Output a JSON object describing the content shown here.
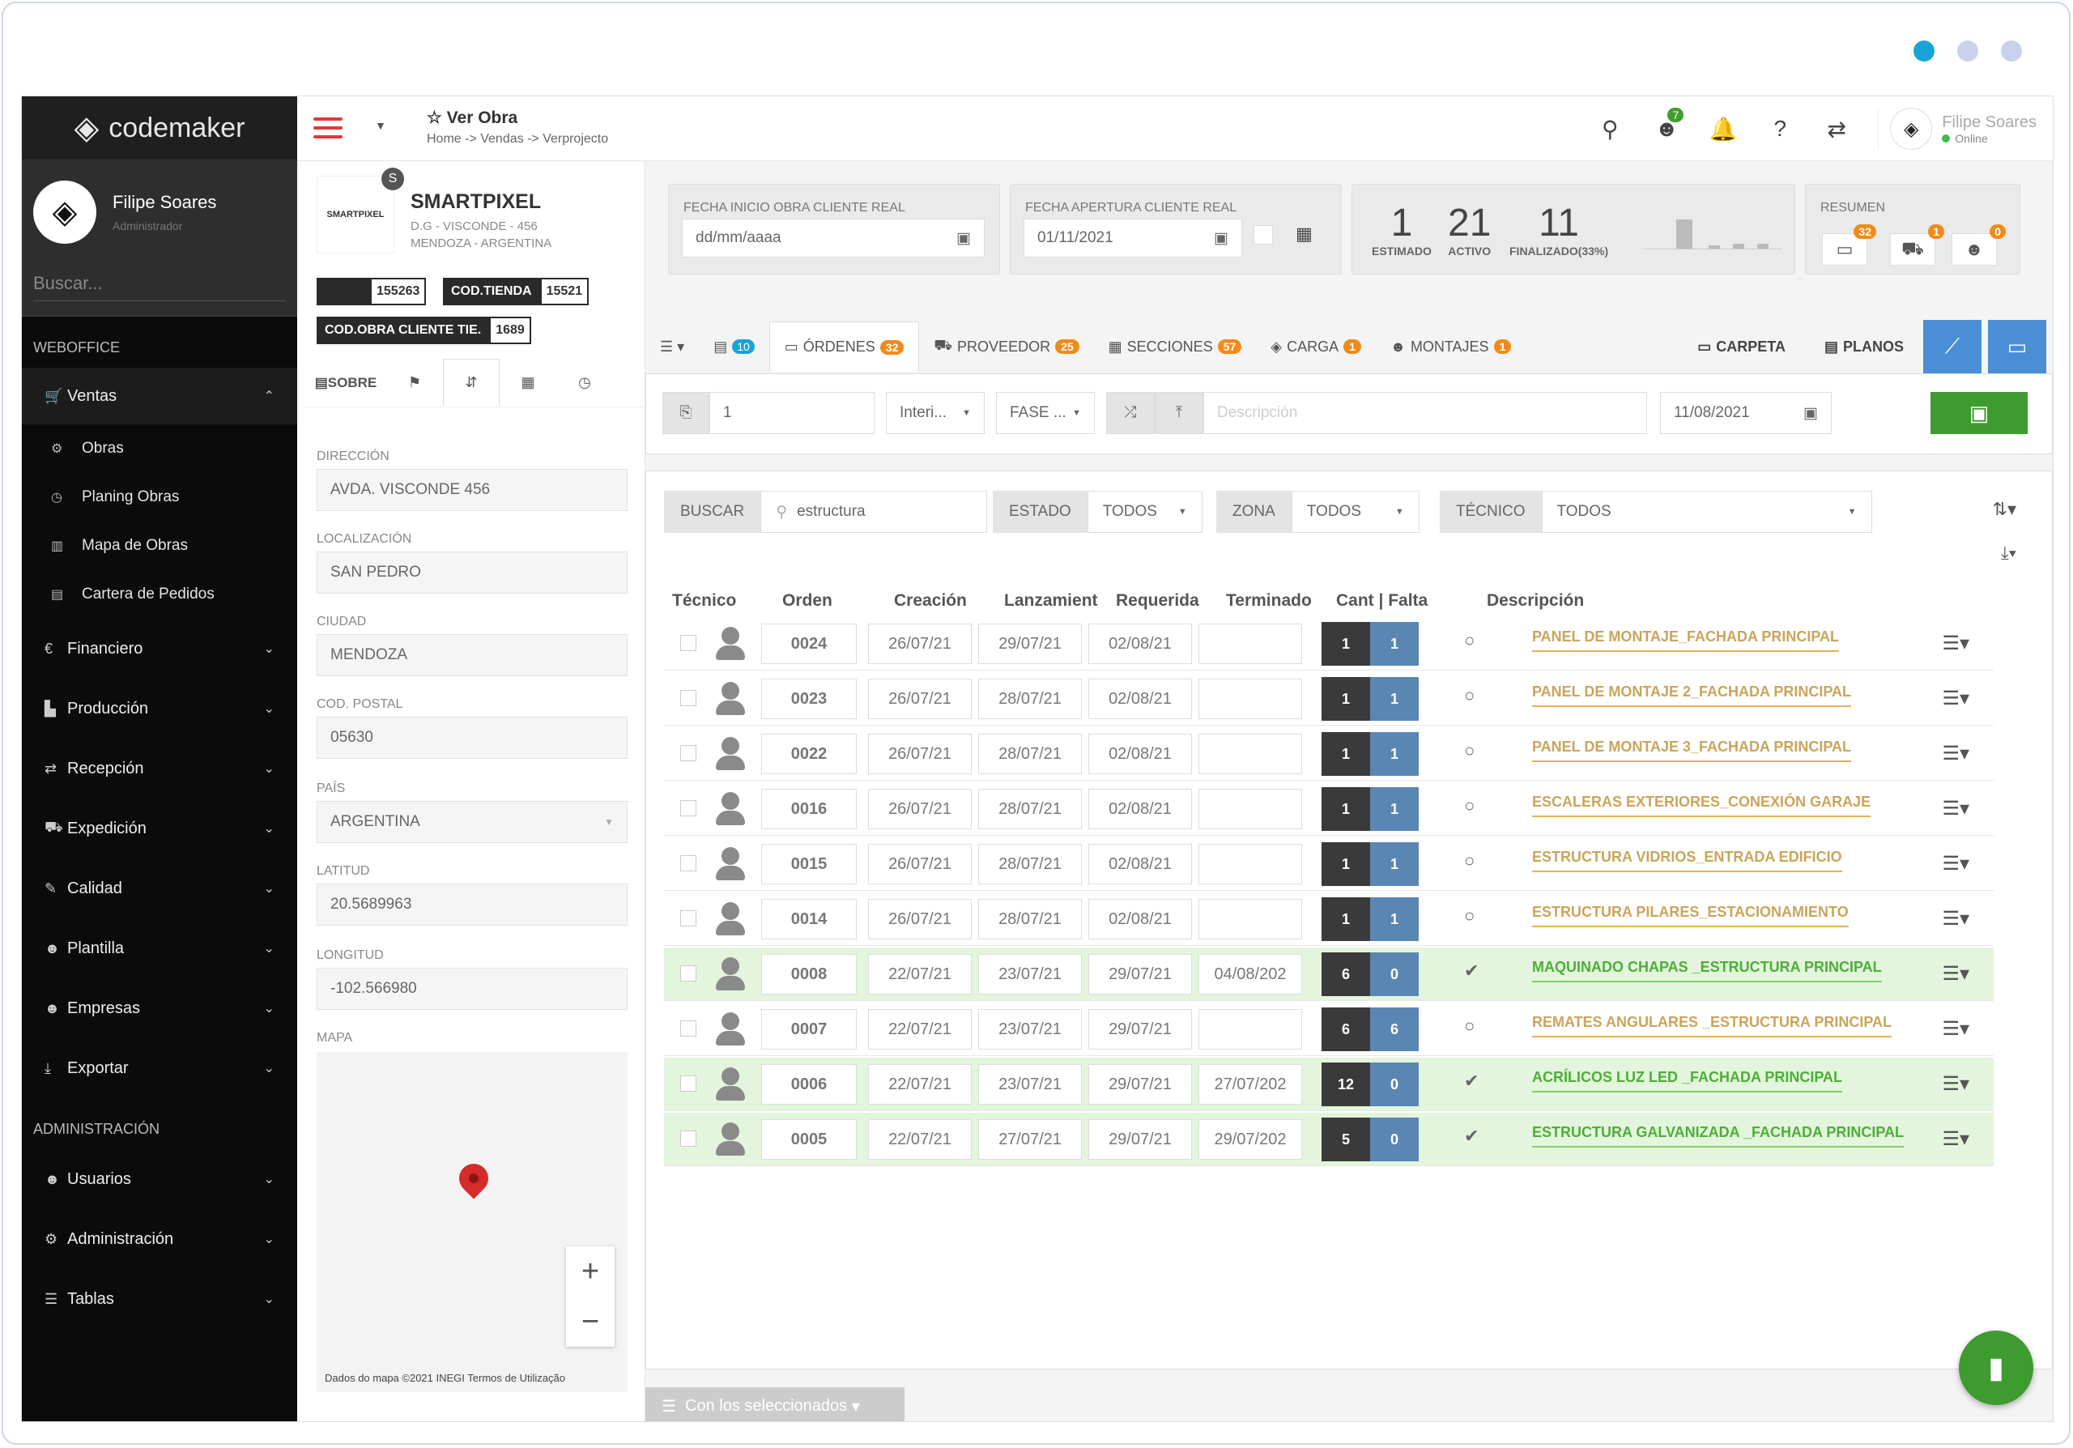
{
  "sidebar": {
    "brand": "codemaker",
    "user": {
      "name": "Filipe Soares",
      "role": "Administrador"
    },
    "search_placeholder": "Buscar...",
    "section1": "WEBOFFICE",
    "section2": "ADMINISTRACIÓN",
    "ventas": "Ventas",
    "ventas_sub": [
      "Obras",
      "Planing Obras",
      "Mapa de Obras",
      "Cartera de Pedidos"
    ],
    "items": [
      "Financiero",
      "Producción",
      "Recepción",
      "Expedición",
      "Calidad",
      "Plantilla",
      "Empresas",
      "Exportar"
    ],
    "admin_items": [
      "Usuarios",
      "Administración",
      "Tablas"
    ]
  },
  "topbar": {
    "title": "Ver Obra",
    "breadcrumb": "Home -> Vendas -> Verprojecto",
    "notif_badge": "7",
    "user_name": "Filipe Soares",
    "user_status": "Online"
  },
  "client": {
    "logo_text": "SMARTPIXEL",
    "avatar_letter": "S",
    "name": "SMARTPIXEL",
    "addr1": "D.G - VISCONDE - 456",
    "addr2": "MENDOZA - ARGENTINA",
    "tag1_value": "155263",
    "tag2_label": "COD.TIENDA",
    "tag2_value": "15521",
    "tag3_label": "COD.OBRA CLIENTE TIE.",
    "tag3_value": "1689",
    "tab_sobre": "SOBRE"
  },
  "fields": {
    "direccion_label": "DIRECCIÓN",
    "direccion": "AVDA. VISCONDE 456",
    "localizacion_label": "LOCALIZACIÓN",
    "localizacion": "SAN PEDRO",
    "ciudad_label": "CIUDAD",
    "ciudad": "MENDOZA",
    "postal_label": "COD. POSTAL",
    "postal": "05630",
    "pais_label": "PAÍS",
    "pais": "ARGENTINA",
    "latitud_label": "LATITUD",
    "latitud": "20.5689963",
    "longitud_label": "LONGITUD",
    "longitud": "-102.566980",
    "mapa_label": "MAPA",
    "map_footer": "Dados do mapa ©2021 INEGI    Termos de Utilização"
  },
  "cards": {
    "inicio_label": "FECHA INICIO OBRA CLIENTE REAL",
    "inicio_value": "dd/mm/aaaa",
    "apertura_label": "FECHA APERTURA CLIENTE REAL",
    "apertura_value": "01/11/2021",
    "estimado": "1",
    "estimado_label": "ESTIMADO",
    "activo": "21",
    "activo_label": "ACTIVO",
    "finalizado": "11",
    "finalizado_label": "FINALIZADO(33%)",
    "resumen_label": "RESUMEN",
    "resumen_badges": [
      "32",
      "1",
      "0"
    ]
  },
  "tabs": {
    "doc_badge": "10",
    "ordenes": "ÓRDENES",
    "ordenes_badge": "32",
    "proveedor": "PROVEEDOR",
    "proveedor_badge": "25",
    "secciones": "SECCIONES",
    "secciones_badge": "57",
    "carga": "CARGA",
    "carga_badge": "1",
    "montajes": "MONTAJES",
    "montajes_badge": "1",
    "carpeta": "CARPETA",
    "planos": "PLANOS"
  },
  "entry": {
    "qty": "1",
    "interior": "Interi...",
    "fase": "FASE ...",
    "desc_placeholder": "Descripción",
    "date": "11/08/2021"
  },
  "filters": {
    "buscar_label": "BUSCAR",
    "buscar_value": "estructura",
    "estado_label": "ESTADO",
    "estado_value": "TODOS",
    "zona_label": "ZONA",
    "zona_value": "TODOS",
    "tecnico_label": "TÉCNICO",
    "tecnico_value": "TODOS"
  },
  "table": {
    "headers": [
      "Técnico",
      "Orden",
      "Creación",
      "Lanzamient",
      "Requerida",
      "Terminado",
      "Cant | Falta",
      "Descripción"
    ],
    "rows": [
      {
        "orden": "0024",
        "creacion": "26/07/21",
        "lanz": "29/07/21",
        "req": "02/08/21",
        "term": "",
        "cant": "1",
        "falta": "1",
        "done": false,
        "desc": "PANEL DE MONTAJE_FACHADA PRINCIPAL"
      },
      {
        "orden": "0023",
        "creacion": "26/07/21",
        "lanz": "28/07/21",
        "req": "02/08/21",
        "term": "",
        "cant": "1",
        "falta": "1",
        "done": false,
        "desc": "PANEL DE MONTAJE 2_FACHADA PRINCIPAL"
      },
      {
        "orden": "0022",
        "creacion": "26/07/21",
        "lanz": "28/07/21",
        "req": "02/08/21",
        "term": "",
        "cant": "1",
        "falta": "1",
        "done": false,
        "desc": "PANEL DE MONTAJE 3_FACHADA PRINCIPAL"
      },
      {
        "orden": "0016",
        "creacion": "26/07/21",
        "lanz": "28/07/21",
        "req": "02/08/21",
        "term": "",
        "cant": "1",
        "falta": "1",
        "done": false,
        "desc": "ESCALERAS EXTERIORES_CONEXIÓN GARAJE"
      },
      {
        "orden": "0015",
        "creacion": "26/07/21",
        "lanz": "28/07/21",
        "req": "02/08/21",
        "term": "",
        "cant": "1",
        "falta": "1",
        "done": false,
        "desc": "ESTRUCTURA VIDRIOS_ENTRADA EDIFICIO"
      },
      {
        "orden": "0014",
        "creacion": "26/07/21",
        "lanz": "28/07/21",
        "req": "02/08/21",
        "term": "",
        "cant": "1",
        "falta": "1",
        "done": false,
        "desc": "ESTRUCTURA PILARES_ESTACIONAMIENTO"
      },
      {
        "orden": "0008",
        "creacion": "22/07/21",
        "lanz": "23/07/21",
        "req": "29/07/21",
        "term": "04/08/202",
        "cant": "6",
        "falta": "0",
        "done": true,
        "desc": "MAQUINADO CHAPAS _ESTRUCTURA PRINCIPAL"
      },
      {
        "orden": "0007",
        "creacion": "22/07/21",
        "lanz": "23/07/21",
        "req": "29/07/21",
        "term": "",
        "cant": "6",
        "falta": "6",
        "done": false,
        "desc": "REMATES ANGULARES _ESTRUCTURA PRINCIPAL"
      },
      {
        "orden": "0006",
        "creacion": "22/07/21",
        "lanz": "23/07/21",
        "req": "29/07/21",
        "term": "27/07/202",
        "cant": "12",
        "falta": "0",
        "done": true,
        "desc": "ACRÍLICOS LUZ LED _FACHADA PRINCIPAL"
      },
      {
        "orden": "0005",
        "creacion": "22/07/21",
        "lanz": "27/07/21",
        "req": "29/07/21",
        "term": "29/07/202",
        "cant": "5",
        "falta": "0",
        "done": true,
        "desc": "ESTRUCTURA GALVANIZADA _FACHADA PRINCIPAL"
      }
    ]
  },
  "bulk_label": "Con los seleccionados",
  "colors": {
    "accent_red": "#e03a3a",
    "green": "#3e9b2f",
    "orange": "#f28a1a",
    "blue": "#4a8fd6"
  }
}
